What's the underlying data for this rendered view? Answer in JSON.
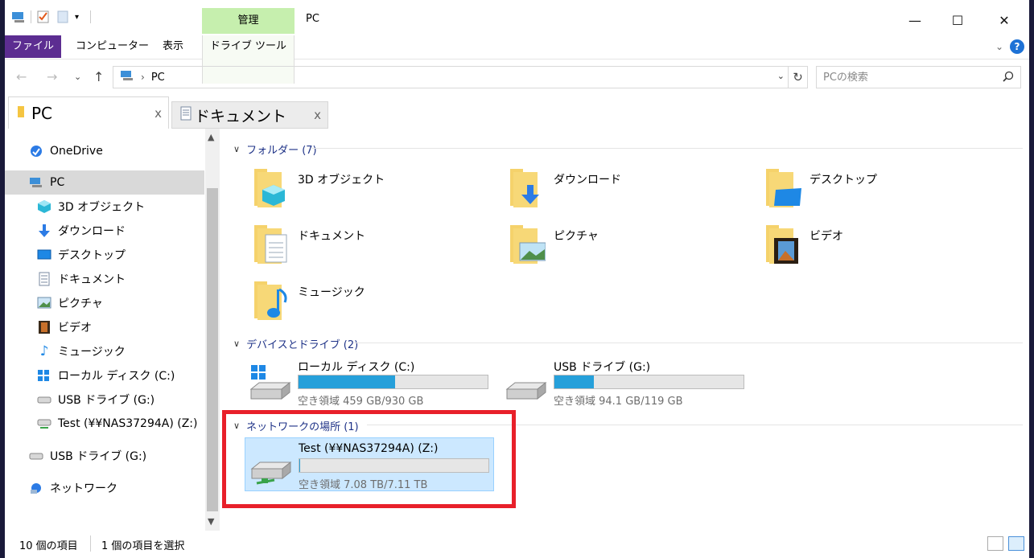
{
  "window": {
    "title": "PC",
    "manage_tab": "管理",
    "controls": {
      "minimize": "—",
      "maximize": "☐",
      "close": "✕"
    }
  },
  "ribbon": {
    "tabs": [
      "ファイル",
      "コンピューター",
      "表示",
      "ドライブ ツール"
    ],
    "help": "?"
  },
  "address": {
    "path": "PC",
    "search_placeholder": "PCの検索"
  },
  "doc_tabs": [
    {
      "label": "PC",
      "close": "x"
    },
    {
      "label": "ドキュメント",
      "close": "x"
    }
  ],
  "nav": {
    "items": [
      {
        "label": "OneDrive",
        "icon": "onedrive-icon"
      },
      {
        "label": "PC",
        "icon": "pc-icon",
        "selected": true
      },
      {
        "label": "3D オブジェクト",
        "icon": "3d-objects-icon"
      },
      {
        "label": "ダウンロード",
        "icon": "download-icon"
      },
      {
        "label": "デスクトップ",
        "icon": "desktop-icon"
      },
      {
        "label": "ドキュメント",
        "icon": "document-icon"
      },
      {
        "label": "ピクチャ",
        "icon": "picture-icon"
      },
      {
        "label": "ビデオ",
        "icon": "video-icon"
      },
      {
        "label": "ミュージック",
        "icon": "music-icon"
      },
      {
        "label": "ローカル ディスク (C:)",
        "icon": "local-disk-icon"
      },
      {
        "label": "USB ドライブ (G:)",
        "icon": "usb-drive-icon"
      },
      {
        "label": "Test (¥¥NAS37294A) (Z:)",
        "icon": "network-drive-icon"
      },
      {
        "label": "USB ドライブ (G:)",
        "icon": "usb-drive-icon"
      },
      {
        "label": "ネットワーク",
        "icon": "network-icon"
      }
    ]
  },
  "content": {
    "folders_header": "フォルダー (7)",
    "folders": [
      "3D オブジェクト",
      "ダウンロード",
      "デスクトップ",
      "ドキュメント",
      "ピクチャ",
      "ビデオ",
      "ミュージック"
    ],
    "devices_header": "デバイスとドライブ (2)",
    "drives": [
      {
        "name": "ローカル ディスク (C:)",
        "free": "空き領域 459 GB/930 GB",
        "used_fraction": 0.51
      },
      {
        "name": "USB ドライブ (G:)",
        "free": "空き領域 94.1 GB/119 GB",
        "used_fraction": 0.21
      }
    ],
    "network_header": "ネットワークの場所 (1)",
    "network_drives": [
      {
        "name": "Test (¥¥NAS37294A) (Z:)",
        "free": "空き領域 7.08 TB/7.11 TB",
        "used_fraction": 0.004
      }
    ]
  },
  "status": {
    "items_count": "10 個の項目",
    "selected": "1 個の項目を選択"
  },
  "colors": {
    "file_tab": "#5c2d91",
    "manage_tab": "#c6efae",
    "bar_fill": "#26a0da",
    "selection": "#cce8ff",
    "highlight_box": "#e8202a"
  }
}
